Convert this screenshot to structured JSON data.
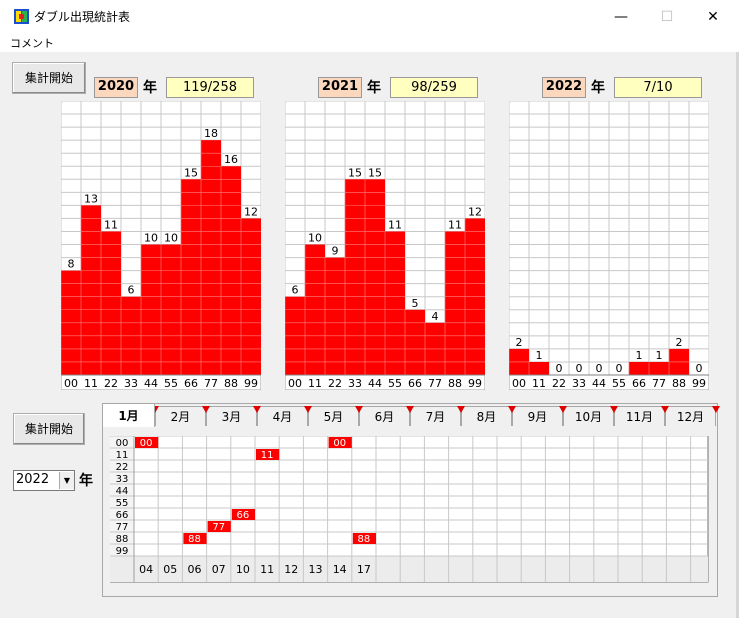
{
  "window": {
    "title": "ダブル出現統計表",
    "minimize_label": "—",
    "maximize_label": "☐",
    "close_label": "✕"
  },
  "menu": {
    "comment": "コメント"
  },
  "top": {
    "start_label": "集計開始",
    "year_suffix": "年"
  },
  "charts_categories": [
    "00",
    "11",
    "22",
    "33",
    "44",
    "55",
    "66",
    "77",
    "88",
    "99"
  ],
  "chart_data": [
    {
      "type": "bar",
      "year": "2020",
      "count": "119/258",
      "categories": [
        "00",
        "11",
        "22",
        "33",
        "44",
        "55",
        "66",
        "77",
        "88",
        "99"
      ],
      "values": [
        8,
        13,
        11,
        6,
        10,
        10,
        15,
        18,
        16,
        12
      ],
      "ylim": [
        0,
        18
      ],
      "grid": true,
      "bar_color": "#ff0000"
    },
    {
      "type": "bar",
      "year": "2021",
      "count": "98/259",
      "categories": [
        "00",
        "11",
        "22",
        "33",
        "44",
        "55",
        "66",
        "77",
        "88",
        "99"
      ],
      "values": [
        6,
        10,
        9,
        15,
        15,
        11,
        5,
        4,
        11,
        12
      ],
      "ylim": [
        0,
        18
      ],
      "grid": true,
      "bar_color": "#ff0000"
    },
    {
      "type": "bar",
      "year": "2022",
      "count": "7/10",
      "categories": [
        "00",
        "11",
        "22",
        "33",
        "44",
        "55",
        "66",
        "77",
        "88",
        "99"
      ],
      "values": [
        2,
        1,
        0,
        0,
        0,
        0,
        1,
        1,
        2,
        0
      ],
      "ylim": [
        0,
        18
      ],
      "grid": true,
      "bar_color": "#ff0000"
    }
  ],
  "bottom": {
    "start_label": "集計開始",
    "year_value": "2022",
    "year_suffix": "年",
    "dropdown_arrow": "▼"
  },
  "tabs": [
    "1月",
    "2月",
    "3月",
    "4月",
    "5月",
    "6月",
    "7月",
    "8月",
    "9月",
    "10月",
    "11月",
    "12月"
  ],
  "active_tab": 0,
  "table": {
    "rows": [
      "00",
      "11",
      "22",
      "33",
      "44",
      "55",
      "66",
      "77",
      "88",
      "99"
    ],
    "days": [
      "04",
      "05",
      "06",
      "07",
      "10",
      "11",
      "12",
      "13",
      "14",
      "17"
    ],
    "hits": [
      {
        "row": 0,
        "col": 0,
        "label": "00"
      },
      {
        "row": 0,
        "col": 8,
        "label": "00"
      },
      {
        "row": 1,
        "col": 5,
        "label": "11"
      },
      {
        "row": 6,
        "col": 4,
        "label": "66"
      },
      {
        "row": 7,
        "col": 3,
        "label": "77"
      },
      {
        "row": 8,
        "col": 2,
        "label": "88"
      },
      {
        "row": 8,
        "col": 9,
        "label": "88"
      }
    ]
  },
  "colors": {
    "bar": "#ff0000",
    "grid": "#c8c8c8",
    "year_bg": "#fad7bd",
    "count_bg": "#ffffc0",
    "tab_marker": "#e00000"
  }
}
